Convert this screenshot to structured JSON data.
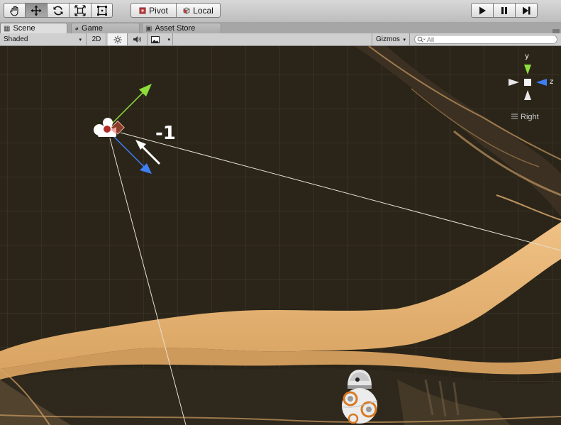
{
  "toolbar": {
    "transform_tools": [
      "hand-tool",
      "move-tool",
      "rotate-tool",
      "scale-tool",
      "rect-tool"
    ],
    "pivot_label": "Pivot",
    "local_label": "Local",
    "playback": [
      "play",
      "pause",
      "step"
    ]
  },
  "tabs": [
    {
      "label": "Scene",
      "icon": "scene-grid-icon",
      "active": true
    },
    {
      "label": "Game",
      "icon": "game-pacman-icon",
      "active": false
    },
    {
      "label": "Asset Store",
      "icon": "store-bag-icon",
      "active": false
    }
  ],
  "scene_toolbar": {
    "shading_mode": "Shaded",
    "mode_2d": "2D",
    "gizmos_label": "Gizmos",
    "search_placeholder": "All"
  },
  "scene": {
    "annotation": "-1",
    "axis_labels": {
      "y": "y",
      "z": "z"
    },
    "view_label": "Right"
  },
  "colors": {
    "sand": "#e9b77a",
    "background": "#2b2519",
    "axis_y": "#8ede3b",
    "axis_z": "#3d7ff5"
  }
}
